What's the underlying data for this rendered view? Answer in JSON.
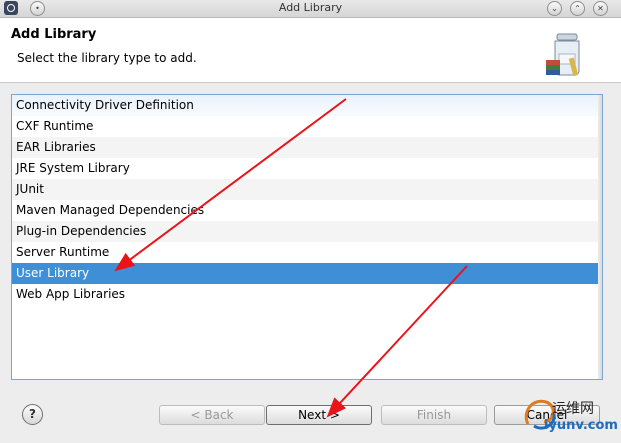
{
  "window": {
    "title": "Add Library"
  },
  "header": {
    "title": "Add Library",
    "description": "Select the library type to add."
  },
  "library_types": [
    "Connectivity Driver Definition",
    "CXF Runtime",
    "EAR Libraries",
    "JRE System Library",
    "JUnit",
    "Maven Managed Dependencies",
    "Plug-in Dependencies",
    "Server Runtime",
    "User Library",
    "Web App Libraries"
  ],
  "selected_library": "User Library",
  "buttons": {
    "help": "?",
    "back": "< Back",
    "next": "Next >",
    "finish": "Finish",
    "cancel": "Cancel"
  },
  "watermark": {
    "site_name": "运维网",
    "url": "iyunv.com"
  },
  "colors": {
    "selection": "#3f8fd6",
    "annotation_arrow": "#e8141a"
  }
}
